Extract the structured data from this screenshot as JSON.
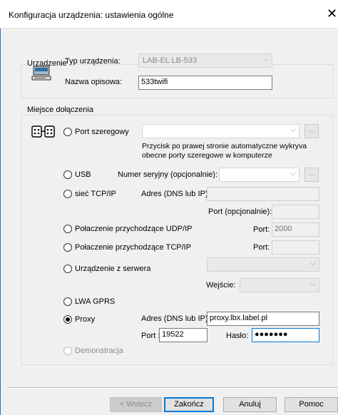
{
  "window": {
    "title": "Konfiguracja urządzenia: ustawienia ogólne",
    "close_symbol": "✕"
  },
  "device_group": {
    "legend": "Urządzenie",
    "type_label": "Typ urządzenia:",
    "type_value": "LAB-EL LB-533",
    "name_label": "Nazwa opisowa:",
    "name_value": "533twifi",
    "icon": "device-icon"
  },
  "connection_group": {
    "legend": "Miejsce dołączenia",
    "icon": "connector-icon",
    "serial": {
      "label": "Port szeregowy",
      "browse": "...",
      "hint": "Przycisk po prawej stronie automatyczne wykryva obecne porty szeregowe w komputerze"
    },
    "usb": {
      "label": "USB",
      "serial_label": "Numer seryjny (opcjonalnie):",
      "browse": "..."
    },
    "tcp": {
      "label": "sieć TCP/IP",
      "address_label": "Adres (DNS lub IP):",
      "port_label": "Port (opcjonalnie):"
    },
    "udp_in": {
      "label": "Połaczenie przychodzące UDP/IP",
      "port_label": "Port:",
      "port_value": "2000"
    },
    "tcp_in": {
      "label": "Połaczenie przychodzące TCP/IP",
      "port_label": "Port:"
    },
    "server": {
      "label": "Urządzenie z serwera",
      "input_label": "Wejście:"
    },
    "gprs": {
      "label": "LWA GPRS"
    },
    "proxy": {
      "label": "Proxy",
      "address_label": "Adres (DNS lub IP):",
      "address_value": "proxy.lbx.label.pl",
      "port_label": "Port :",
      "port_value": "19522",
      "password_label": "Hasło:",
      "password_value": "●●●●●●●",
      "selected": true
    },
    "demo": {
      "label": "Demonstracja"
    }
  },
  "buttons": {
    "back": "< Wstecz",
    "finish": "Zakończ",
    "cancel": "Anuluj",
    "help": "Pomoc"
  }
}
